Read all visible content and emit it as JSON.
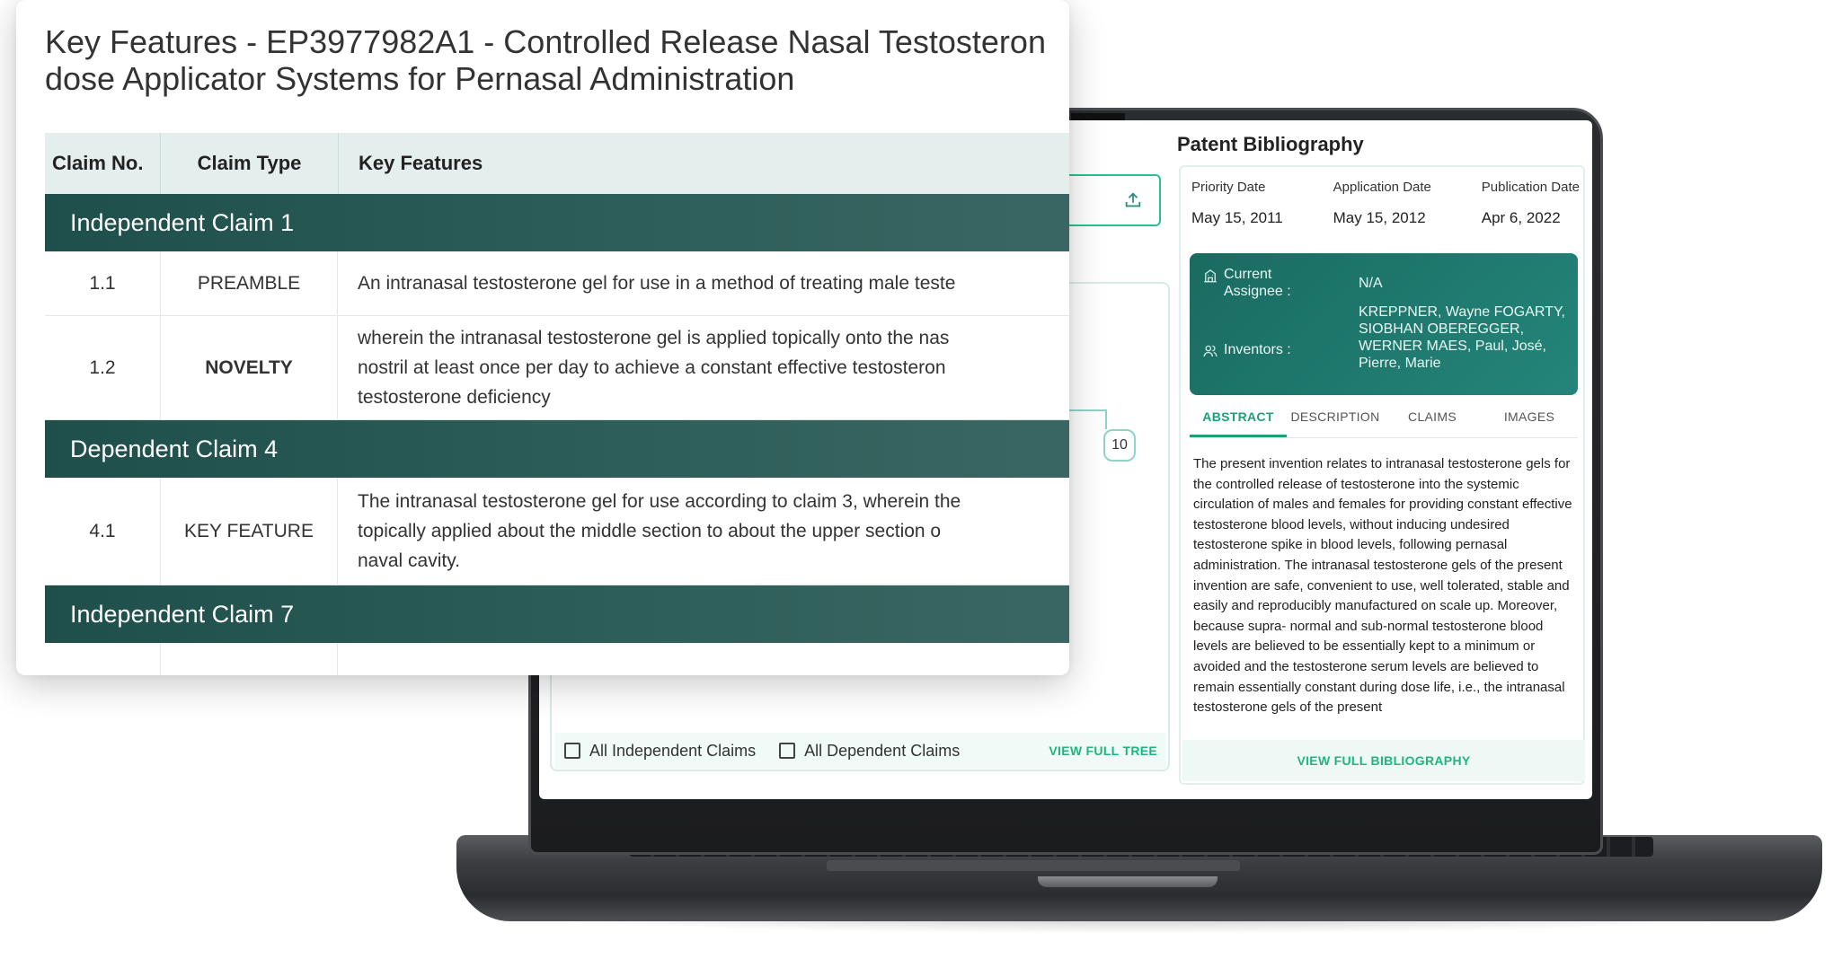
{
  "key_features": {
    "title_line1": "Key Features - EP3977982A1 - Controlled Release Nasal Testosteron",
    "title_line2": "dose Applicator Systems for Pernasal Administration",
    "headers": {
      "claim_no": "Claim No.",
      "claim_type": "Claim Type",
      "key_features": "Key Features"
    },
    "sections": {
      "s1": "Independent Claim 1",
      "s2": "Dependent Claim 4",
      "s3": "Independent Claim 7"
    },
    "rows": {
      "r1": {
        "no": "1.1",
        "type": "PREAMBLE",
        "line1": "An intranasal testosterone gel for use in a method of treating male teste"
      },
      "r2": {
        "no": "1.2",
        "type": "NOVELTY",
        "line1": "wherein the intranasal testosterone gel is applied topically onto the nas",
        "line2": "nostril at least once per day to achieve a constant effective testosteron",
        "line3": "testosterone deficiency"
      },
      "r3": {
        "no": "4.1",
        "type": "KEY FEATURE",
        "line1": "The intranasal testosterone gel for use according to claim 3, wherein the",
        "line2": "topically applied about the middle section to about the upper section o",
        "line3": "naval cavity."
      }
    }
  },
  "claim_tree": {
    "node_label": "10",
    "all_independent": "All Independent Claims",
    "all_dependent": "All Dependent Claims",
    "view_full_tree": "VIEW FULL TREE"
  },
  "bibliography": {
    "title": "Patent Bibliography",
    "priority_label": "Priority Date",
    "priority_value": "May 15, 2011",
    "application_label": "Application Date",
    "application_value": "May 15, 2012",
    "publication_label": "Publication Date",
    "publication_value": "Apr 6, 2022",
    "assignee_label1": "Current",
    "assignee_label2": "Assignee :",
    "assignee_value": "N/A",
    "inventors_label": "Inventors :",
    "inventors_value": "KREPPNER, Wayne FOGARTY, SIOBHAN OBEREGGER, WERNER MAES, Paul, José, Pierre, Marie",
    "tabs": {
      "abstract": "ABSTRACT",
      "description": "DESCRIPTION",
      "claims": "CLAIMS",
      "images": "IMAGES"
    },
    "abstract_text": "The present invention relates to intranasal testosterone gels for the controlled release of testosterone into the systemic circulation of males and females for providing constant effective testosterone blood levels, without inducing undesired testosterone spike in blood levels, following pernasal administration. The intranasal testosterone gels of the present invention are safe, convenient to use, well tolerated, stable and easily and reproducibly manufactured on scale up. Moreover, because supra- normal and sub-normal testosterone blood levels are believed to be essentially kept to a minimum or avoided and the testosterone serum levels are believed to remain essentially constant during dose life, i.e., the intranasal testosterone gels of the present",
    "view_full_bibliography": "VIEW FULL BIBLIOGRAPHY"
  },
  "icons": {
    "export": "upload-icon",
    "assignee": "building-icon",
    "inventors": "people-icon"
  },
  "colors": {
    "accent": "#21b57d",
    "section": "#2a5a55",
    "card": "#1d7468"
  }
}
